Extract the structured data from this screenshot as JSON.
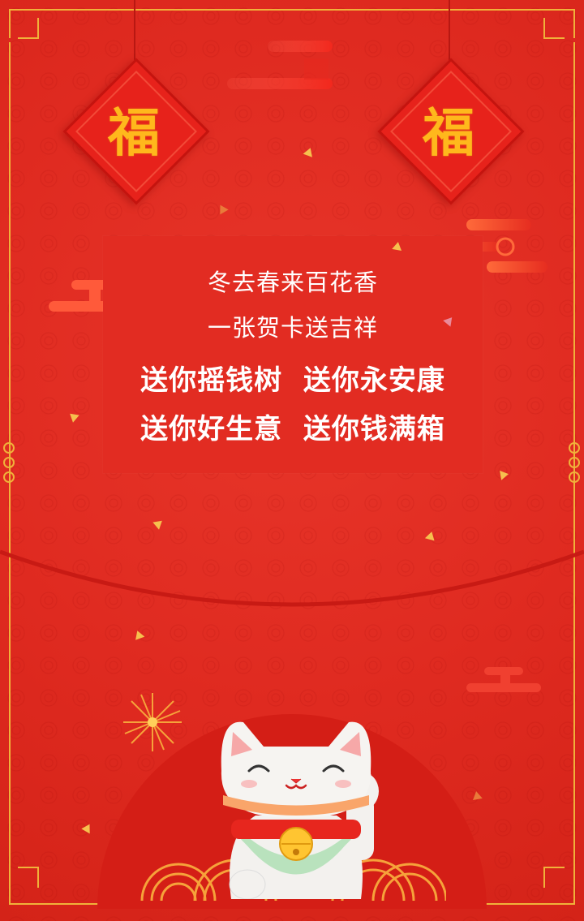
{
  "card": {
    "lines": [
      "冬去春来百花香",
      "一张贺卡送吉祥",
      "送你摇钱树  送你永安康",
      "送你好生意  送你钱满箱"
    ]
  },
  "decorations": {
    "fu_character": "福",
    "lantern_color": "#e7221b",
    "gold_color": "#f0b23a",
    "background_color": "#df2a20",
    "icons": [
      "fu-diamond-icon",
      "cloud-icon",
      "firework-icon",
      "lucky-cat-icon",
      "wave-icon"
    ]
  }
}
